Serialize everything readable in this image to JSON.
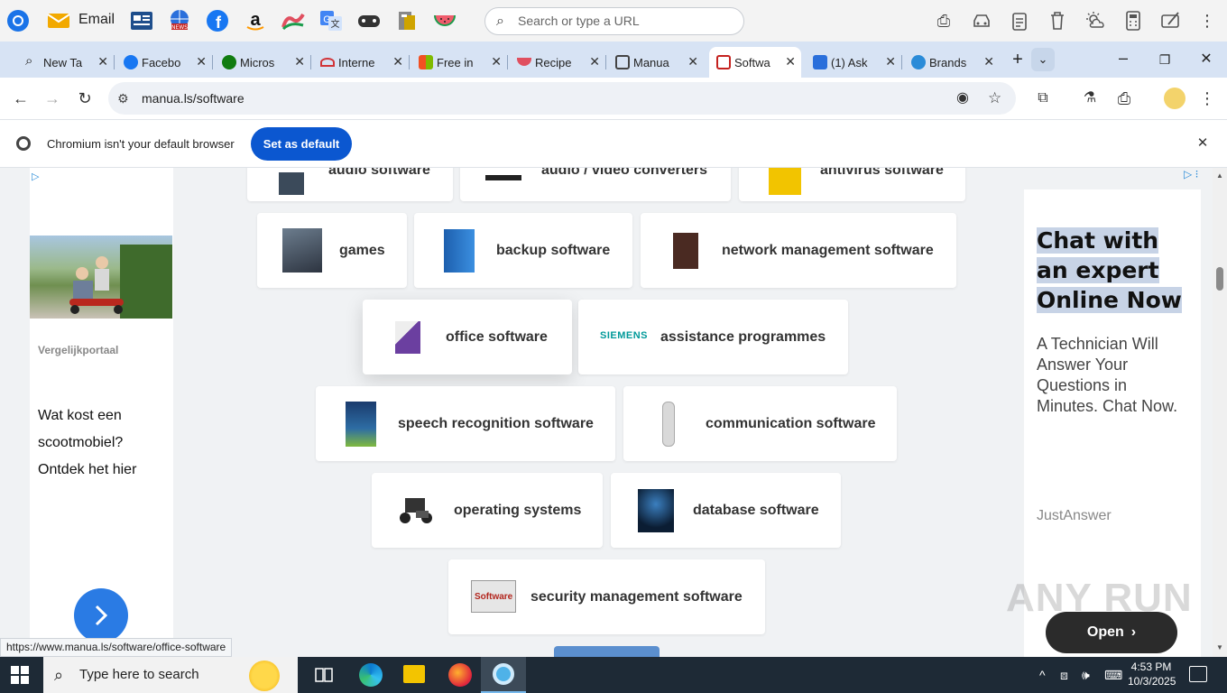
{
  "topbar": {
    "email_label": "Email",
    "search_placeholder": "Search or type a URL"
  },
  "tabs": [
    {
      "label": "New Ta",
      "color": "#ffffff"
    },
    {
      "label": "Facebo",
      "color": "#1877f2"
    },
    {
      "label": "Micros",
      "color": "#107c10"
    },
    {
      "label": "Interne",
      "color": "#d13438"
    },
    {
      "label": "Free in",
      "color": "#f25022"
    },
    {
      "label": "Recipe",
      "color": "#e04f5f"
    },
    {
      "label": "Manua",
      "color": "#444444"
    },
    {
      "label": "Softwa",
      "color": "#c5221f"
    },
    {
      "label": "(1) Ask",
      "color": "#2a6fdb"
    },
    {
      "label": "Brands",
      "color": "#2a8bd8"
    }
  ],
  "omnibar": {
    "url": "manua.ls/software"
  },
  "infobar": {
    "message": "Chromium isn't your default browser",
    "button_label": "Set as default"
  },
  "categories": {
    "row0": [
      "audio software",
      "audio / video converters",
      "antivirus software"
    ],
    "row1": [
      "games",
      "backup software",
      "network management software"
    ],
    "row2": [
      "office software",
      "assistance programmes"
    ],
    "row3": [
      "speech recognition software",
      "communication software"
    ],
    "row4": [
      "operating systems",
      "database software"
    ],
    "row5": [
      "security management software"
    ]
  },
  "thumb_text": {
    "siemens": "SIEMENS",
    "surveillance": "Software"
  },
  "left_ad": {
    "source": "Vergelijkportaal",
    "text_line1": "Wat kost een",
    "text_line2": "scootmobiel?",
    "text_line3": "Ontdek het hier"
  },
  "right_ad": {
    "headline": "Chat with an expert Online Now",
    "body": "A Technician Will Answer Your Questions in Minutes. Chat Now.",
    "source": "JustAnswer",
    "open_label": "Open"
  },
  "status_url": "https://www.manua.ls/software/office-software",
  "taskbar": {
    "search_placeholder": "Type here to search",
    "time": "4:53 PM",
    "date": "10/3/2025"
  },
  "watermark": "ANY RUN"
}
